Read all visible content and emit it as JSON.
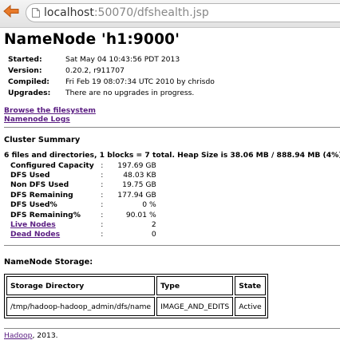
{
  "browser": {
    "url_host": "localhost",
    "url_rest": ":50070/dfshealth.jsp",
    "icons": {
      "back": "back-arrow-icon",
      "page": "page-icon"
    }
  },
  "page": {
    "title": "NameNode 'h1:9000'",
    "info": [
      {
        "key": "Started:",
        "value": "Sat May 04 10:43:56 PDT 2013"
      },
      {
        "key": "Version:",
        "value": "0.20.2, r911707"
      },
      {
        "key": "Compiled:",
        "value": "Fri Feb 19 08:07:34 UTC 2010 by chrisdo"
      },
      {
        "key": "Upgrades:",
        "value": "There are no upgrades in progress."
      }
    ],
    "links": {
      "browse": "Browse the filesystem",
      "logs": "Namenode Logs"
    },
    "cluster": {
      "heading": "Cluster Summary",
      "summary_line": "6 files and directories, 1 blocks = 7 total. Heap Size is 38.06 MB / 888.94 MB (4%)",
      "colon": ":",
      "rows": [
        {
          "key": "Configured Capacity",
          "value": "197.69 GB"
        },
        {
          "key": "DFS Used",
          "value": "48.03 KB"
        },
        {
          "key": "Non DFS Used",
          "value": "19.75 GB"
        },
        {
          "key": "DFS Remaining",
          "value": "177.94 GB"
        },
        {
          "key": "DFS Used%",
          "value": "0 %"
        },
        {
          "key": "DFS Remaining%",
          "value": "90.01 %"
        }
      ],
      "live_nodes": {
        "label": "Live Nodes",
        "value": "2"
      },
      "dead_nodes": {
        "label": "Dead Nodes",
        "value": "0"
      }
    },
    "storage": {
      "heading": "NameNode Storage:",
      "headers": [
        "Storage Directory",
        "Type",
        "State"
      ],
      "rows": [
        [
          "/tmp/hadoop-hadoop_admin/dfs/name",
          "IMAGE_AND_EDITS",
          "Active"
        ]
      ]
    },
    "footer": {
      "link": "Hadoop",
      "text": ", 2013."
    }
  },
  "colors": {
    "link": "#5a1d82",
    "back_arrow": "#e87a2a"
  }
}
